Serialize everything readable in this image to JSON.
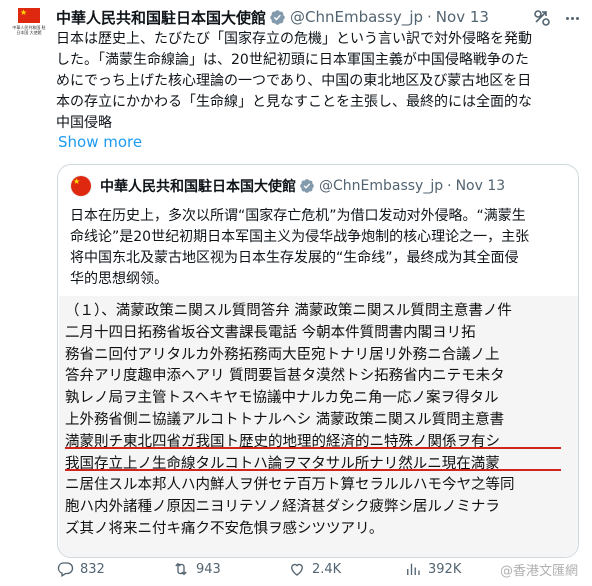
{
  "author": {
    "name": "中華人民共和国駐日本国大使館",
    "handle": "@ChnEmbassy_jp",
    "separator": "·",
    "date": "Nov 13",
    "avatar_text": "中華人民共和国 駐日本国 大使館"
  },
  "tweet": {
    "text": "日本は歴史上、たびたび「国家存立の危機」という言い訳で対外侵略を発動\nした。「満蒙生命線論」は、20世紀初頭に日本軍国主義が中国侵略戦争のた\nめにでっち上げた核心理論の一つであり、中国の東北地区及び蒙古地区を日\n本の存立にかかわる「生命線」と見なすことを主張し、最終的には全面的な\n中国侵略",
    "show_more": "Show more"
  },
  "quote": {
    "name": "中華人民共和国駐日本国大使館",
    "handle": "@ChnEmbassy_jp",
    "separator": "·",
    "date": "Nov 13",
    "text": "日本在历史上，多次以所谓“国家存亡危机”为借口发动对外侵略。“满蒙生\n命线论”是20世纪初期日本军国主义为侵华战争炮制的核心理论之一，主张\n将中国东北及蒙古地区视为日本生存发展的“生命线”，最终成为其全面侵\n华的思想纲领。",
    "document_text": "（１）、満蒙政策ニ関スル質問答弁 満蒙政策ニ関スル質問主意書ノ件\n二月十四日拓務省坂谷文書課長電話 今朝本件質問書内閣ヨリ拓\n務省ニ回付アリタルカ外務拓務両大臣宛トナリ居リ外務ニ合議ノ上\n答弁アリ度趣申添ヘアリ 質問要旨甚タ漠然トシ拓務省内ニテモ未タ\n孰レノ局ヲ主管トスヘキヤモ協議中ナルカ免ニ角一応ノ案ヲ得タル\n上外務省側ニ協議アルコトトナルヘシ 満蒙政策ニ関スル質問主意書\n満蒙則チ東北四省ガ我国ト歴史的地理的経済的ニ特殊ノ関係ヲ有シ\n我国存立上ノ生命線タルコトハ論ヲマタサル所ナリ然ルニ現在満蒙\nニ居住スル本邦人ハ内鮮人ヲ併セテ百万ト算セラルルハモ今ヤ之等同\n胞ハ内外諸種ノ原因ニヨリテソノ経済甚ダシク疲弊シ居ルノミナラ\nズ其ノ将来ニ付キ痛ク不安危惧ヲ感シツツアリ。"
  },
  "actions": {
    "replies": "832",
    "reposts": "943",
    "likes": "2.4K",
    "views": "392K"
  },
  "watermark": "@香港文匯網",
  "colors": {
    "link": "#1d9bf0",
    "verified": "#829aab",
    "secondary_text": "#536471",
    "underline": "#d0261d",
    "flag_red": "#de2910",
    "flag_star": "#ffde00"
  },
  "icons": [
    "verified-badge-icon",
    "translate-icon",
    "more-options-icon",
    "reply-icon",
    "repost-icon",
    "like-icon",
    "views-icon"
  ]
}
